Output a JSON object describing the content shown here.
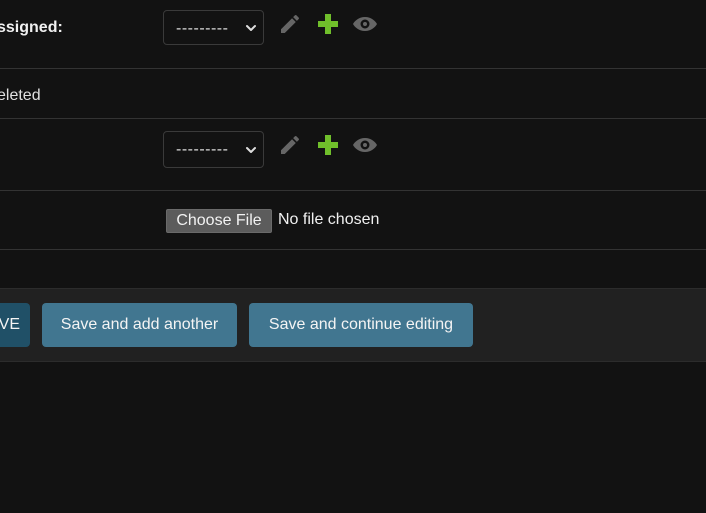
{
  "form": {
    "rows": [
      {
        "label": "ssigned:",
        "select_value": "---------",
        "actions": [
          "pencil-icon",
          "plus-icon",
          "eye-icon"
        ]
      },
      {
        "label": "eleted"
      },
      {
        "select_value": "---------",
        "actions": [
          "pencil-icon",
          "plus-icon",
          "eye-icon"
        ]
      },
      {
        "file_button": "Choose File",
        "file_status": "No file chosen"
      }
    ]
  },
  "submit": {
    "save_label": "VE",
    "save_add_label": "Save and add another",
    "save_continue_label": "Save and continue editing"
  },
  "colors": {
    "background": "#121212",
    "submit_bar": "#212121",
    "primary_button": "#205067",
    "secondary_button": "#417690",
    "add_icon": "#70bf2b",
    "muted_icon": "#666666",
    "divider": "#333333"
  }
}
